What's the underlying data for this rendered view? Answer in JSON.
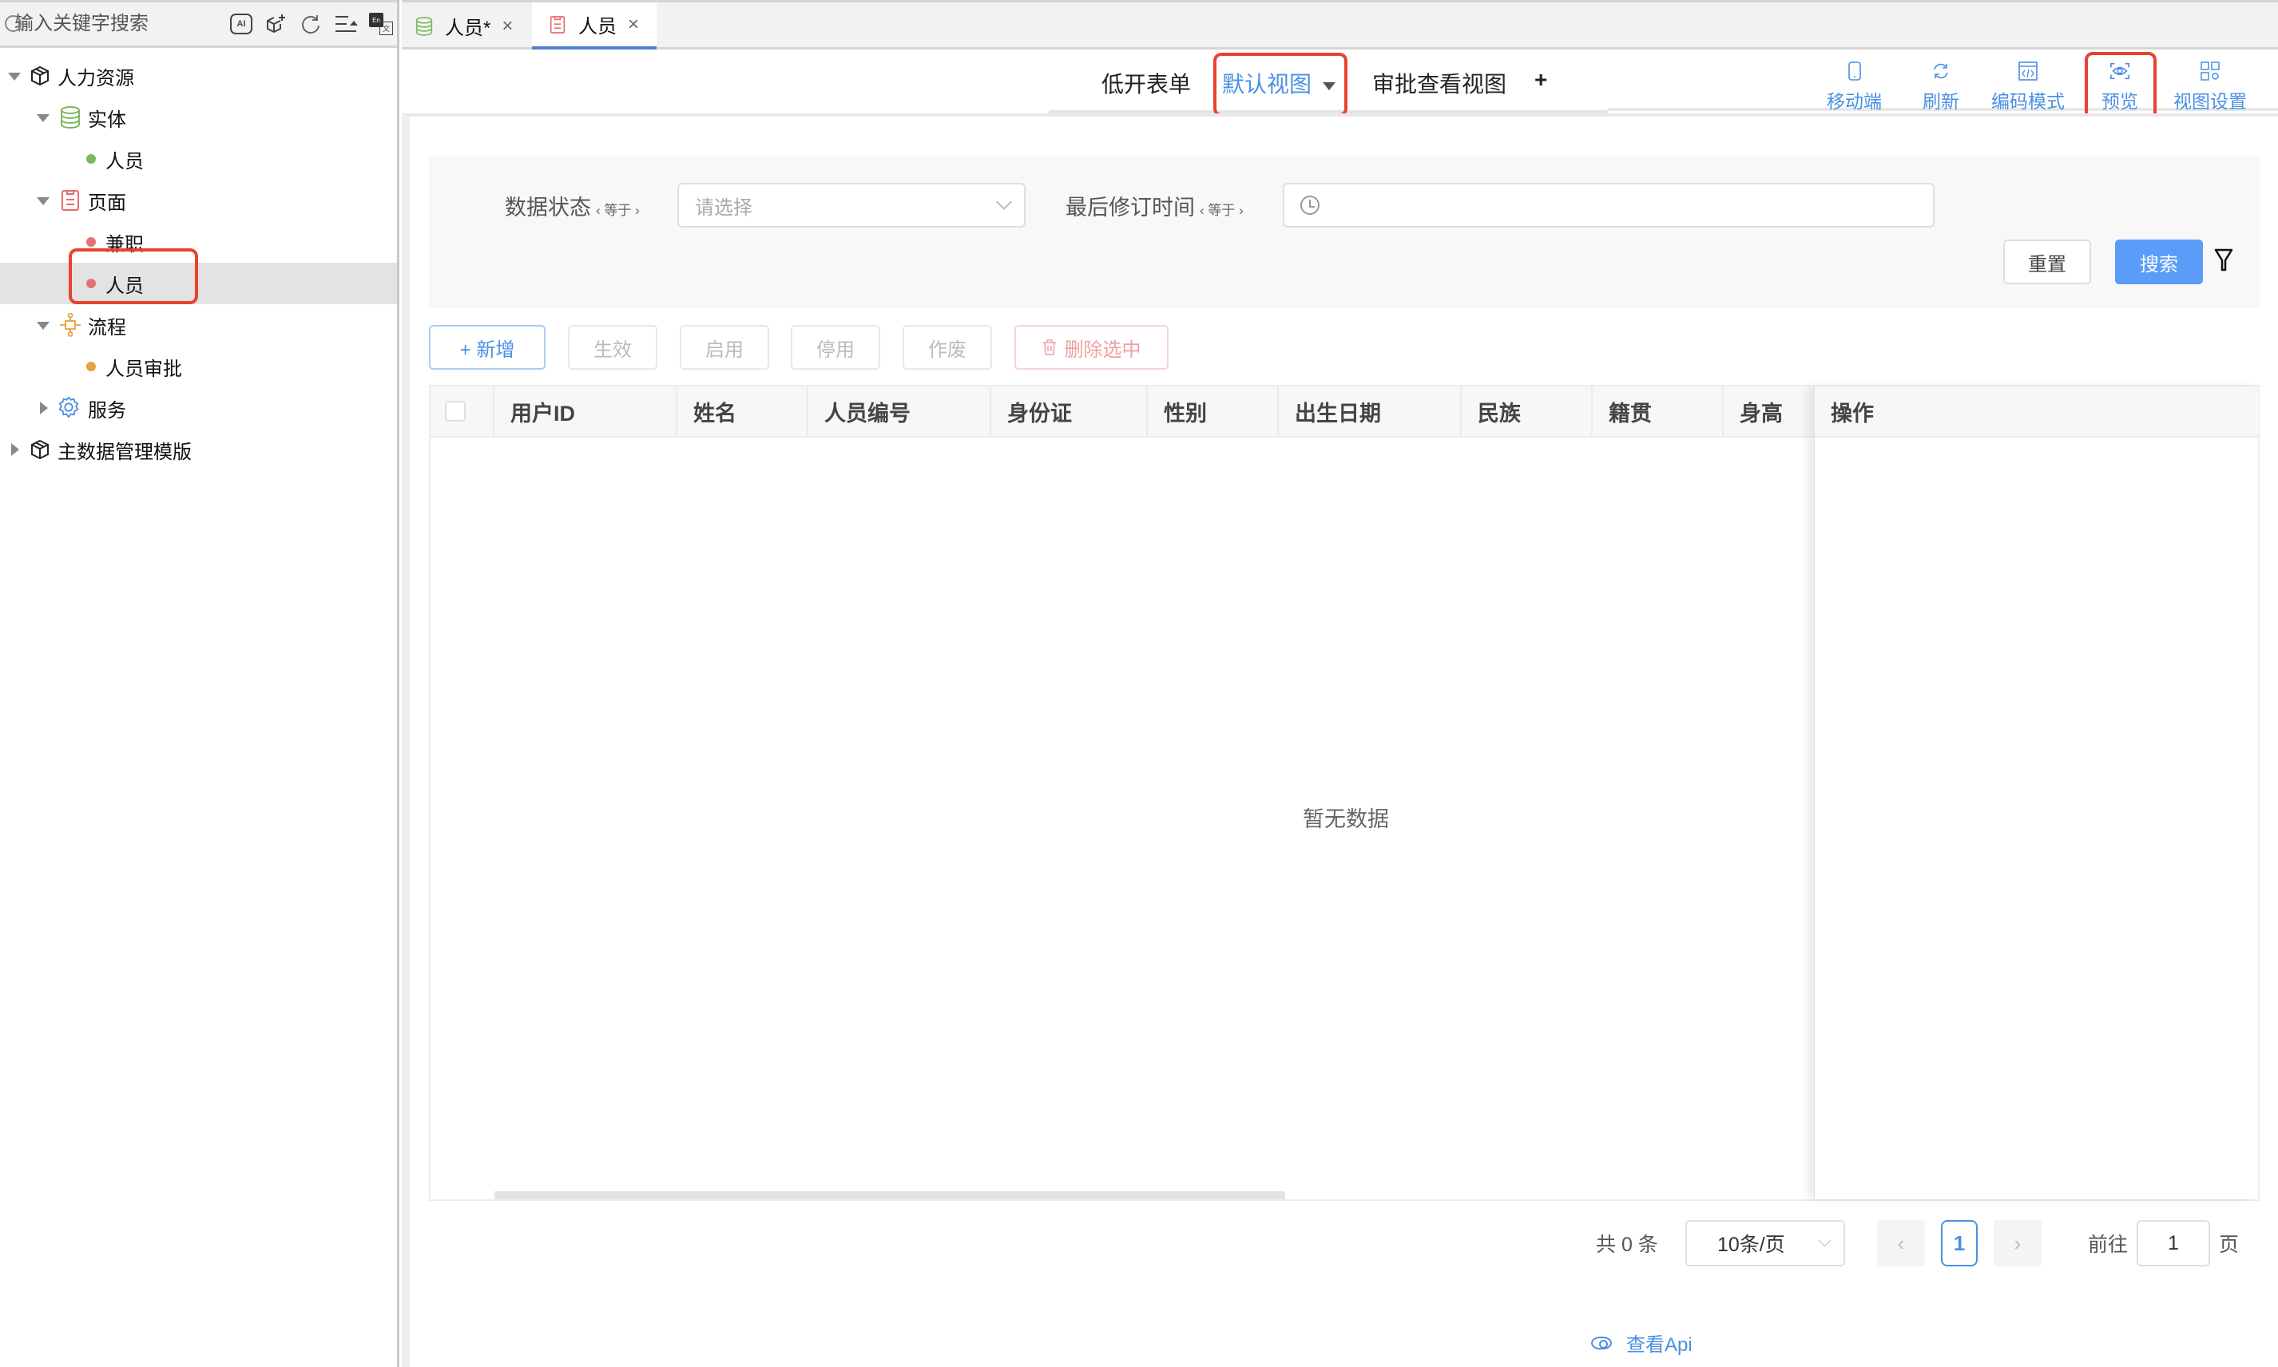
{
  "sidebar": {
    "search_placeholder": "输入关键字搜索",
    "tool_icons": [
      "ai-icon",
      "add-cube-icon",
      "refresh-icon",
      "collapse-list-icon",
      "language-switch-icon"
    ],
    "ai_label": "AI",
    "lang_en": "En",
    "lang_zh": "文",
    "tree": [
      {
        "label": "人力资源",
        "level": 0,
        "expanded": true,
        "icon": "cube-icon"
      },
      {
        "label": "实体",
        "level": 1,
        "expanded": true,
        "icon": "database-icon",
        "color": "#7cb862"
      },
      {
        "label": "人员",
        "level": 2,
        "dot_color": "#7cb862"
      },
      {
        "label": "页面",
        "level": 1,
        "expanded": true,
        "icon": "page-icon",
        "color": "#e86b6b"
      },
      {
        "label": "兼职",
        "level": 2,
        "dot_color": "#e57373"
      },
      {
        "label": "人员",
        "level": 2,
        "dot_color": "#e57373",
        "selected": true
      },
      {
        "label": "流程",
        "level": 1,
        "expanded": true,
        "icon": "flow-icon",
        "color": "#e8a040"
      },
      {
        "label": "人员审批",
        "level": 2,
        "dot_color": "#e8a040"
      },
      {
        "label": "服务",
        "level": 1,
        "expanded": false,
        "icon": "gear-icon",
        "color": "#4a90e2"
      },
      {
        "label": "主数据管理模版",
        "level": 0,
        "expanded": false,
        "icon": "cube-icon"
      }
    ]
  },
  "doc_tabs": [
    {
      "label": "人员*",
      "icon": "database-icon",
      "active": false
    },
    {
      "label": "人员",
      "icon": "page-icon",
      "active": true
    }
  ],
  "view_tabs": {
    "items": [
      {
        "label": "低开表单",
        "active": false
      },
      {
        "label": "默认视图",
        "active": true
      },
      {
        "label": "审批查看视图",
        "active": false
      }
    ],
    "add_label": "+"
  },
  "toolbar": [
    {
      "label": "移动端",
      "icon": "mobile-icon"
    },
    {
      "label": "刷新",
      "icon": "refresh-icon"
    },
    {
      "label": "编码模式",
      "icon": "code-icon"
    },
    {
      "label": "预览",
      "icon": "preview-eye-icon"
    },
    {
      "label": "视图设置",
      "icon": "grid-settings-icon"
    }
  ],
  "filters": {
    "status_label": "数据状态",
    "status_op": "‹ 等于 ›",
    "status_placeholder": "请选择",
    "time_label": "最后修订时间",
    "time_op": "‹ 等于 ›",
    "time_value": "",
    "reset_label": "重置",
    "search_label": "搜索"
  },
  "actions": {
    "add": "+ 新增",
    "effective": "生效",
    "enable": "启用",
    "disable": "停用",
    "void": "作废",
    "delete_selected": "删除选中"
  },
  "table": {
    "columns": [
      "用户ID",
      "姓名",
      "人员编号",
      "身份证",
      "性别",
      "出生日期",
      "民族",
      "籍贯",
      "身高"
    ],
    "op_column": "操作",
    "rows": [],
    "empty_text": "暂无数据"
  },
  "pagination": {
    "total_text": "共 0 条",
    "page_size": "10条/页",
    "prev": "‹",
    "current_page": "1",
    "next": "›",
    "goto_label": "前往",
    "goto_value": "1",
    "page_suffix": "页"
  },
  "api_link": "查看Api",
  "colors": {
    "accent": "#4a90e2",
    "search_button": "#5a9cf8",
    "highlight_box": "#e8432d",
    "active_tab_underline": "#4f7fc9"
  }
}
